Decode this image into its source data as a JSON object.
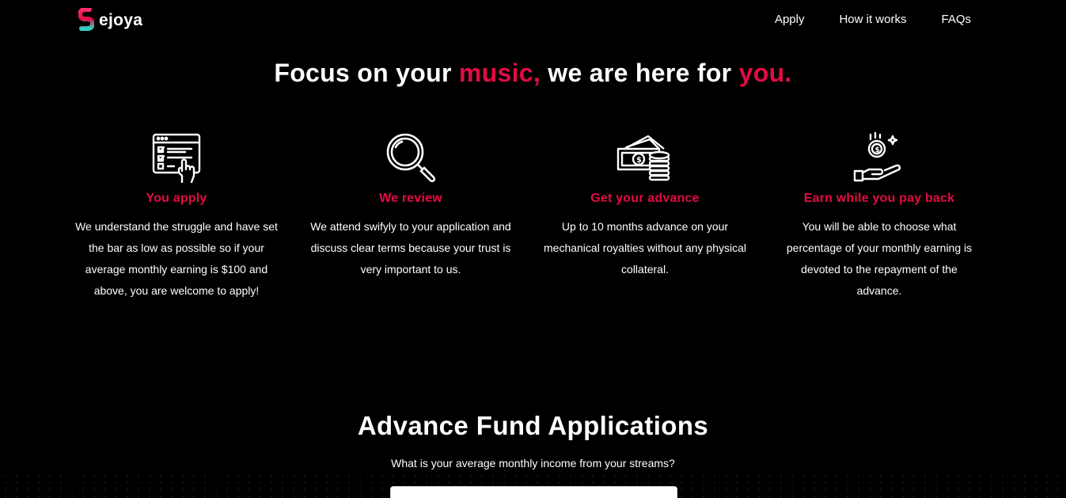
{
  "brand": {
    "name": "ejoya",
    "accent_color": "#e30b43"
  },
  "nav": {
    "items": [
      "Apply",
      "How it works",
      "FAQs"
    ]
  },
  "hero": {
    "part1": "Focus on your ",
    "accent1": "music,",
    "part2": " we are here for ",
    "accent2": "you."
  },
  "features": [
    {
      "icon": "checklist-click-icon",
      "title": "You apply",
      "text": "We understand the struggle and have set the bar as low as possible so if your average monthly earning is $100 and above, you are welcome to apply!"
    },
    {
      "icon": "magnifier-icon",
      "title": "We review",
      "text": "We attend swifyly to your application and discuss clear terms because your trust is very important to us."
    },
    {
      "icon": "cash-coins-icon",
      "title": "Get your advance",
      "text": "Up to 10 months advance on your mechanical royalties without any physical collateral."
    },
    {
      "icon": "hand-coin-icon",
      "title": "Earn while you pay back",
      "text": "You will be able to choose what percentage of your monthly earning is devoted to the repayment of the advance."
    }
  ],
  "advance": {
    "title": "Advance Fund Applications",
    "question": "What is your average monthly income from your streams?"
  }
}
